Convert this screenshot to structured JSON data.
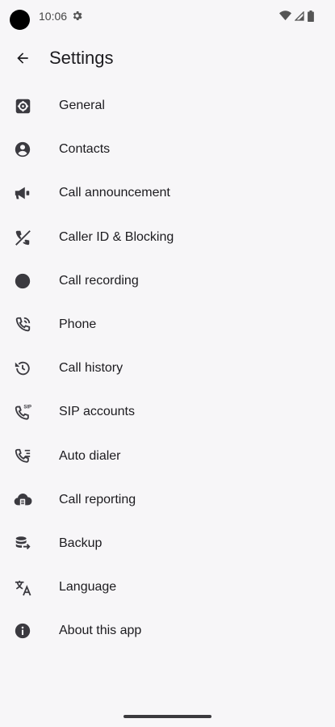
{
  "status_bar": {
    "time": "10:06"
  },
  "app_bar": {
    "title": "Settings"
  },
  "settings": {
    "items": [
      {
        "label": "General",
        "icon": "gear-icon"
      },
      {
        "label": "Contacts",
        "icon": "account-circle-icon"
      },
      {
        "label": "Call announcement",
        "icon": "megaphone-icon"
      },
      {
        "label": "Caller ID & Blocking",
        "icon": "phone-blocked-icon"
      },
      {
        "label": "Call recording",
        "icon": "record-icon"
      },
      {
        "label": "Phone",
        "icon": "phone-in-talk-icon"
      },
      {
        "label": "Call history",
        "icon": "history-icon"
      },
      {
        "label": "SIP accounts",
        "icon": "sip-phone-icon"
      },
      {
        "label": "Auto dialer",
        "icon": "phone-list-icon"
      },
      {
        "label": "Call reporting",
        "icon": "cloud-report-icon"
      },
      {
        "label": "Backup",
        "icon": "database-backup-icon"
      },
      {
        "label": "Language",
        "icon": "translate-icon"
      },
      {
        "label": "About this app",
        "icon": "info-icon"
      }
    ]
  },
  "colors": {
    "background": "#f7f6f8",
    "text": "#1c1b1f",
    "icon": "#3b3a40"
  }
}
